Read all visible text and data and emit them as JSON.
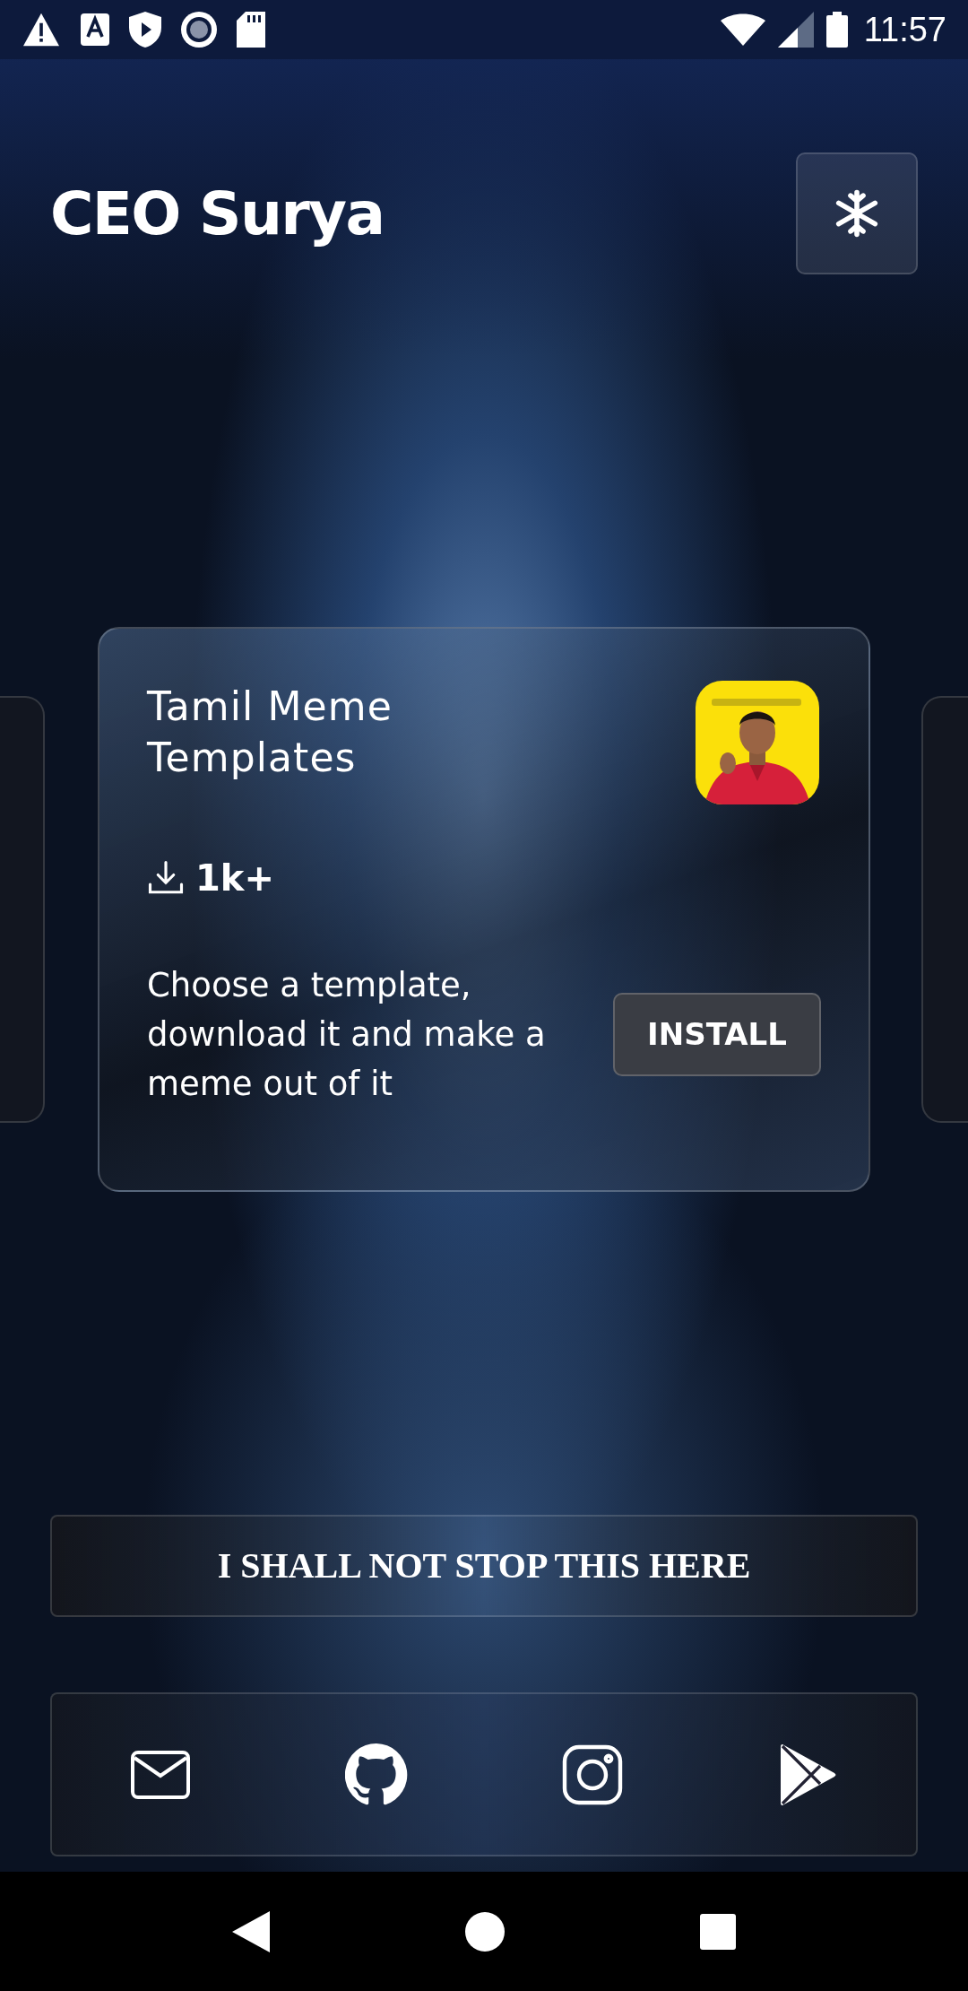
{
  "status_bar": {
    "time": "11:57"
  },
  "header": {
    "title": "CEO Surya"
  },
  "app_card": {
    "title": "Tamil Meme Templates",
    "downloads": "1k+",
    "description": "Choose a template, download it and make a meme out of it",
    "button": "INSTALL"
  },
  "quote": "I SHALL NOT STOP THIS HERE",
  "social_links": [
    {
      "kind": "mail"
    },
    {
      "kind": "github"
    },
    {
      "kind": "instagram"
    },
    {
      "kind": "play"
    }
  ]
}
